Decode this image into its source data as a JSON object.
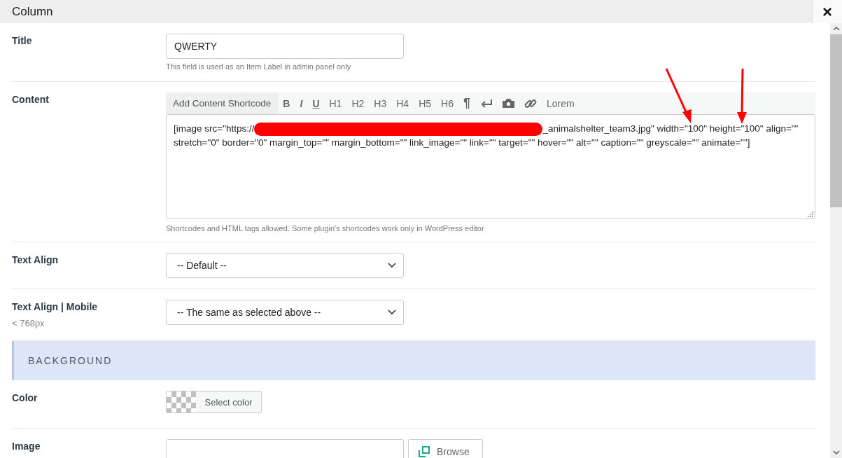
{
  "window": {
    "title": "Column",
    "close": "×"
  },
  "fields": [
    {
      "kind": "text",
      "label": "Title",
      "value": "QWERTY",
      "hint": "This field is used as an Item Label in admin panel only"
    },
    {
      "kind": "editor",
      "label": "Content",
      "toolbar": [
        {
          "kind": "shortcode",
          "label": "Add Content Shortcode"
        },
        {
          "kind": "bold",
          "label": "B"
        },
        {
          "kind": "italic",
          "label": "I"
        },
        {
          "kind": "underline",
          "label": "U"
        },
        {
          "kind": "plain",
          "label": "H1"
        },
        {
          "kind": "plain",
          "label": "H2"
        },
        {
          "kind": "plain",
          "label": "H3"
        },
        {
          "kind": "plain",
          "label": "H4"
        },
        {
          "kind": "plain",
          "label": "H5"
        },
        {
          "kind": "plain",
          "label": "H6"
        },
        {
          "kind": "bold",
          "label": "¶"
        },
        {
          "kind": "return"
        },
        {
          "kind": "camera"
        },
        {
          "kind": "link"
        },
        {
          "kind": "plain",
          "label": "Lorem"
        }
      ],
      "text_before_redaction": "[image src=\"https://",
      "text_after_redaction": "_animalshelter_team3.jpg\" width=\"100\" height=\"100\" align=\"\"",
      "second_line": "stretch=\"0\" border=\"0\" margin_top=\"\" margin_bottom=\"\" link_image=\"\" link=\"\" target=\"\" hover=\"\" alt=\"\" caption=\"\" greyscale=\"\" animate=\"\"]",
      "hint": "Shortcodes and HTML tags allowed. Some plugin's shortcodes work only in WordPress editor"
    },
    {
      "kind": "select",
      "label": "Text Align",
      "value": "-- Default --"
    },
    {
      "kind": "select",
      "label": "Text Align | Mobile",
      "sublabel": "< 768px",
      "value": "-- The same as selected above --"
    },
    {
      "kind": "section",
      "label": "BACKGROUND"
    },
    {
      "kind": "color",
      "label": "Color",
      "button": "Select color"
    },
    {
      "kind": "image",
      "label": "Image",
      "button": "Browse"
    }
  ]
}
